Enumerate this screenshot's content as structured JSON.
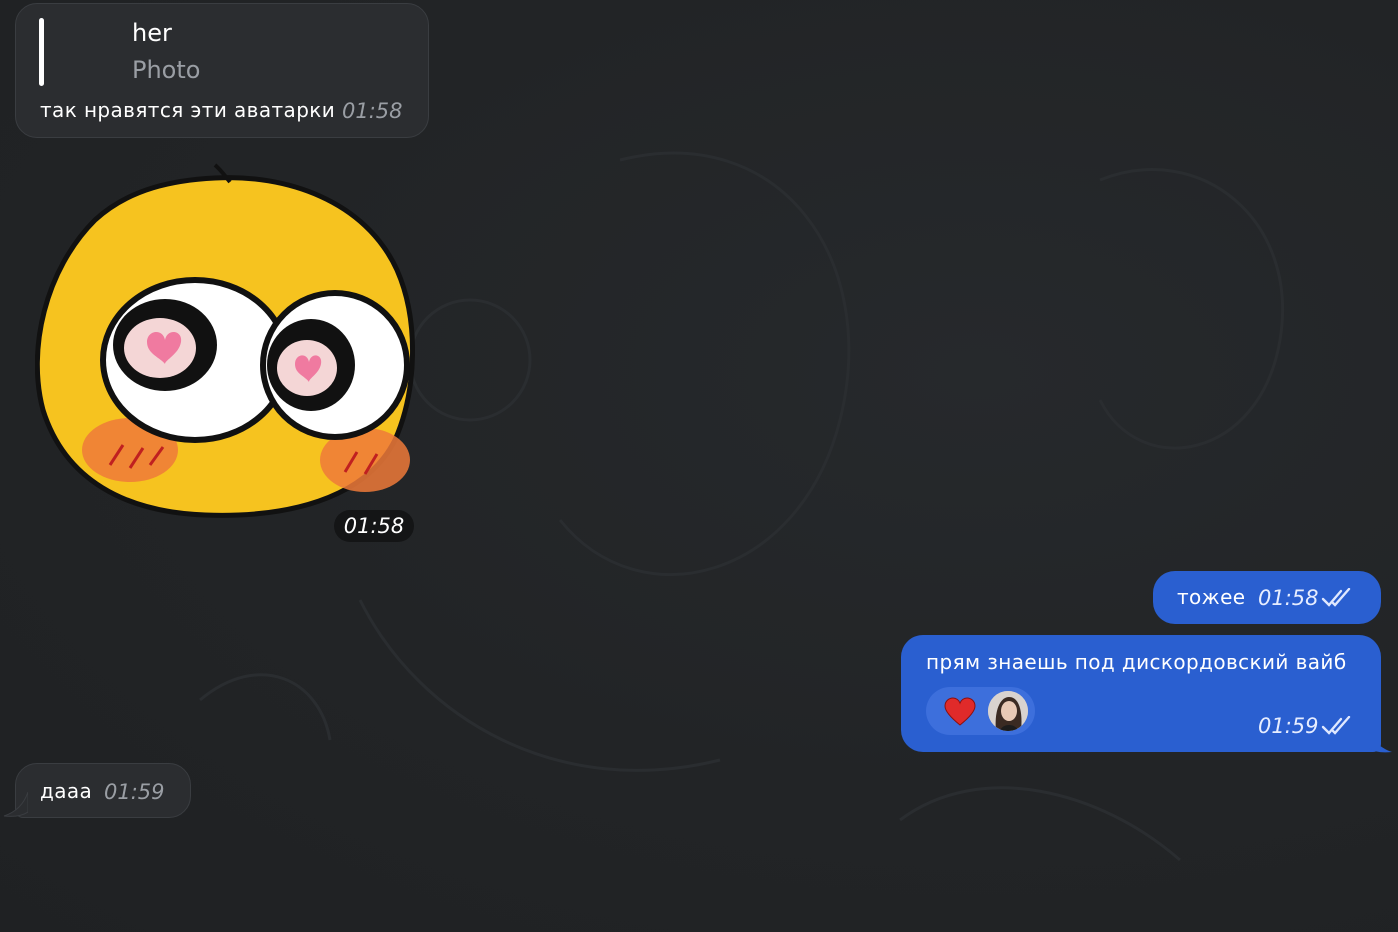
{
  "messages": [
    {
      "direction": "incoming",
      "reply": {
        "name": "her",
        "subtitle": "Photo"
      },
      "text": "так нравятся эти аватарки",
      "time": "01:58"
    },
    {
      "direction": "incoming",
      "sticker": "cute-blushing-emoji",
      "time": "01:58"
    },
    {
      "direction": "outgoing",
      "text": "тожее",
      "time": "01:58",
      "status": "double-check-icon"
    },
    {
      "direction": "outgoing",
      "text": "прям знаешь под дискордовский вайб",
      "time": "01:59",
      "status": "double-check-icon",
      "reactions": [
        {
          "icon": "heart-icon",
          "color": "#e02a2a"
        }
      ]
    },
    {
      "direction": "incoming",
      "text": "дааа",
      "time": "01:59"
    }
  ],
  "colors": {
    "background": "#222426",
    "incoming_bubble": "#2b2d30",
    "outgoing_bubble": "#2a5fd0",
    "reaction_pill": "#3d6fdc"
  }
}
